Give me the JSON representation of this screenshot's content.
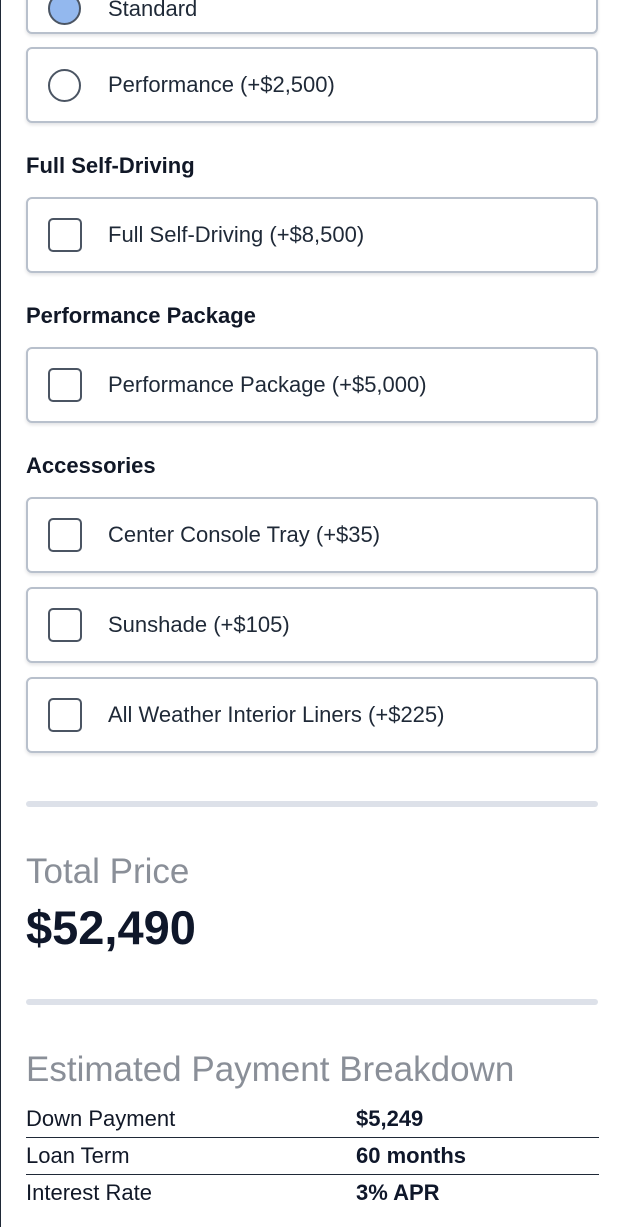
{
  "motor": {
    "options": [
      {
        "label": "Standard",
        "selected": true
      },
      {
        "label": "Performance (+$2,500)",
        "selected": false
      }
    ]
  },
  "full_self_driving": {
    "heading": "Full Self-Driving",
    "option_label": "Full Self-Driving (+$8,500)"
  },
  "performance_package": {
    "heading": "Performance Package",
    "option_label": "Performance Package (+$5,000)"
  },
  "accessories": {
    "heading": "Accessories",
    "items": [
      {
        "label": "Center Console Tray (+$35)"
      },
      {
        "label": "Sunshade (+$105)"
      },
      {
        "label": "All Weather Interior Liners (+$225)"
      }
    ]
  },
  "total": {
    "label": "Total Price",
    "value": "$52,490"
  },
  "breakdown": {
    "title": "Estimated Payment Breakdown",
    "rows": [
      {
        "key": "Down Payment",
        "value": "$5,249"
      },
      {
        "key": "Loan Term",
        "value": "60 months"
      },
      {
        "key": "Interest Rate",
        "value": "3% APR"
      }
    ]
  }
}
